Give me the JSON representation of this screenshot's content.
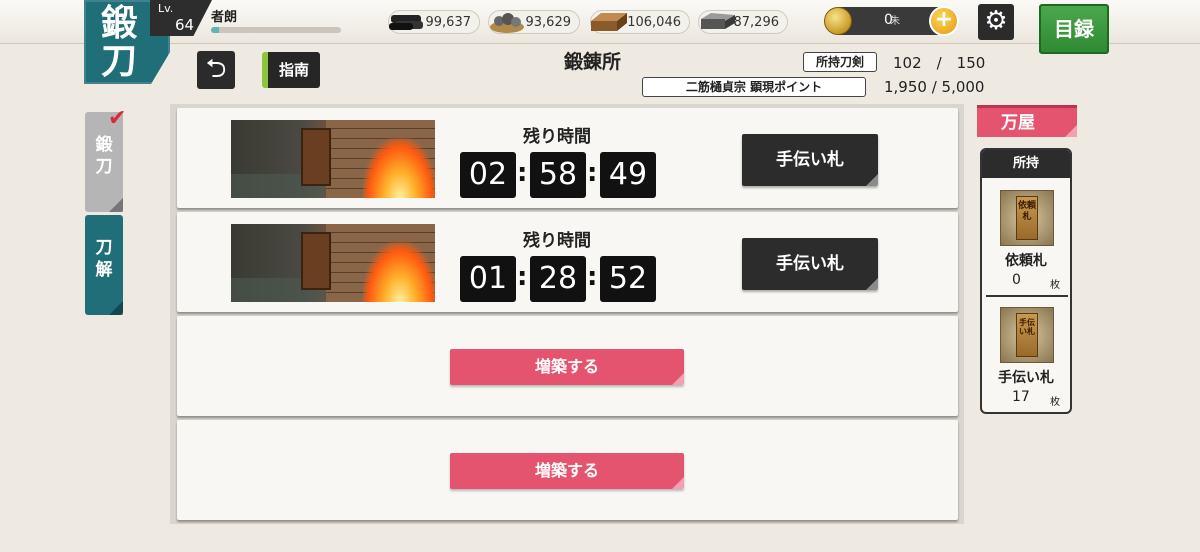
{
  "header": {
    "page_badge": "鍛刀",
    "level_label": "Lv.",
    "level": "64",
    "player_name": "者朗",
    "xp_fraction": 0.06,
    "resources": [
      {
        "icon": "charcoal-icon",
        "value": "99,637"
      },
      {
        "icon": "tamahagane-icon",
        "value": "93,629"
      },
      {
        "icon": "cooling-material-icon",
        "value": "106,046"
      },
      {
        "icon": "whetstone-icon",
        "value": "87,296"
      }
    ],
    "koban": {
      "value": "0",
      "unit": "朱"
    },
    "plus_label": "+",
    "catalog_label": "目録"
  },
  "subheader": {
    "guide_label": "指南",
    "title": "鍛錬所",
    "owned_swords_label": "所持刀剣",
    "owned_swords_value": "102　/　150",
    "points_label": "二筋樋貞宗 顕現ポイント",
    "points_value": "1,950 / 5,000"
  },
  "side_tabs": [
    {
      "label": "鍛刀",
      "active": true
    },
    {
      "label": "刀解",
      "active": false
    }
  ],
  "slots": [
    {
      "remaining_label": "残り時間",
      "timer": [
        "02",
        "58",
        "49"
      ],
      "assist_label": "手伝い札"
    },
    {
      "remaining_label": "残り時間",
      "timer": [
        "01",
        "28",
        "52"
      ],
      "assist_label": "手伝い札"
    },
    {
      "expand_label": "増築する"
    },
    {
      "expand_label": "増築する"
    }
  ],
  "shop": {
    "label": "万屋"
  },
  "inventory": {
    "header": "所持",
    "items": [
      {
        "card_text": "依頼札",
        "name": "依頼札",
        "count": "0",
        "unit": "枚"
      },
      {
        "card_text": "手伝い札",
        "name": "手伝い札",
        "count": "17",
        "unit": "枚"
      }
    ]
  },
  "colors": {
    "teal": "#1f6e78",
    "pink": "#e5546e",
    "green": "#3a9a3e",
    "dark": "#2c2c2c"
  }
}
